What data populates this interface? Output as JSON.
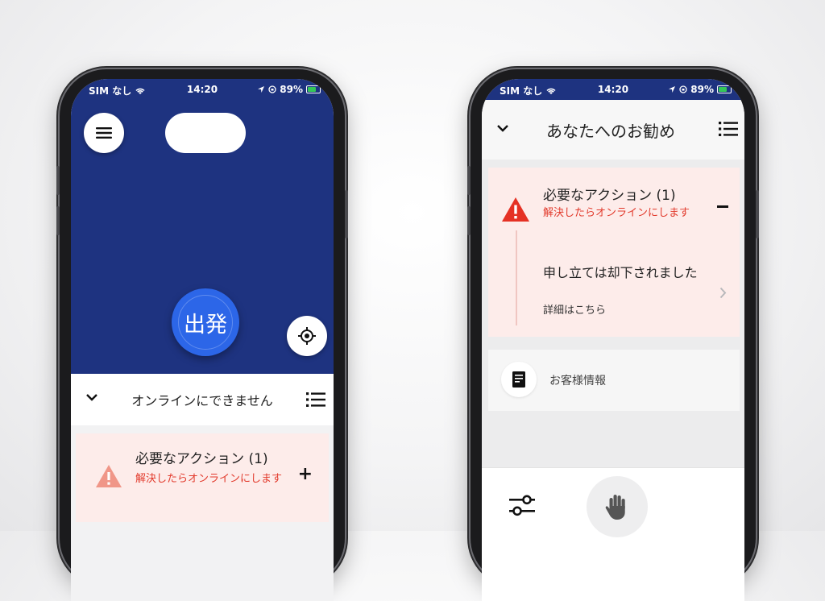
{
  "status_bar": {
    "carrier": "SIM なし",
    "time": "14:20",
    "battery": "89%"
  },
  "driver_home": {
    "go_button_label": "出発",
    "sheet_title": "オンラインにできません",
    "action_card": {
      "title": "必要なアクション (1)",
      "subtitle": "解決したらオンラインにします",
      "expand_symbol": "+"
    },
    "colors": {
      "map": "#1e3380",
      "go_button": "#2c66e8",
      "alert": "#e23a2c"
    }
  },
  "recommendations": {
    "header_title": "あなたへのお勧め",
    "action_card": {
      "title": "必要なアクション (1)",
      "subtitle": "解決したらオンラインにします",
      "item_title": "申し立ては却下されました",
      "item_subtitle": "詳細はこちら"
    },
    "customer_info_label": "お客様情報"
  }
}
